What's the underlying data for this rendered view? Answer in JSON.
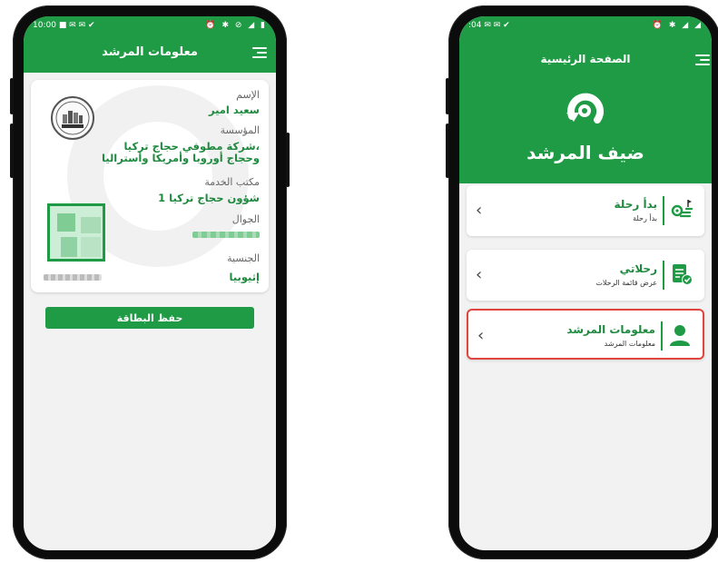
{
  "left_screen": {
    "status": {
      "time": "10:00",
      "icons_left": "■ ✉ ✉ ✔",
      "icons_right": "⏰ ✱ ⊘ ◢ ▮"
    },
    "appbar": {
      "title": "معلومات المرشد"
    },
    "card": {
      "name_label": "الإسم",
      "name_value": "سعيد امير",
      "org_label": "المؤسسة",
      "org_value_line1": "شركة مطوفي حجاج تركيا،",
      "org_value_line2": "وحجاج أوروبا وأمريكا وأستراليا",
      "office_label": "مكتب الخدمة",
      "office_value": "شؤون حجاج تركيا 1",
      "mobile_label": "الجوال",
      "nationality_label": "الجنسية",
      "nationality_value": "إثيوبيا"
    },
    "save_button": "حفظ البطاقة"
  },
  "right_screen": {
    "status": {
      "time": ":04",
      "icons_left": "✉ ✉ ✔",
      "icons_right": "⏰ ✱ ◢ ◢"
    },
    "hero": {
      "title": "الصفحة الرئيسية",
      "guest_label": "ضيف المرشد"
    },
    "menu": [
      {
        "title": "بدأ رحلة",
        "subtitle": "بدأ رحلة",
        "icon": "route-pin-icon"
      },
      {
        "title": "رحلاتي",
        "subtitle": "عرض قائمة الرحلات",
        "icon": "trips-document-icon"
      },
      {
        "title": "معلومات المرشد",
        "subtitle": "معلومات المرشد",
        "icon": "user-icon"
      }
    ]
  },
  "colors": {
    "primary": "#1f9a45",
    "highlight": "#e0463f",
    "background": "#f2f2f2"
  }
}
